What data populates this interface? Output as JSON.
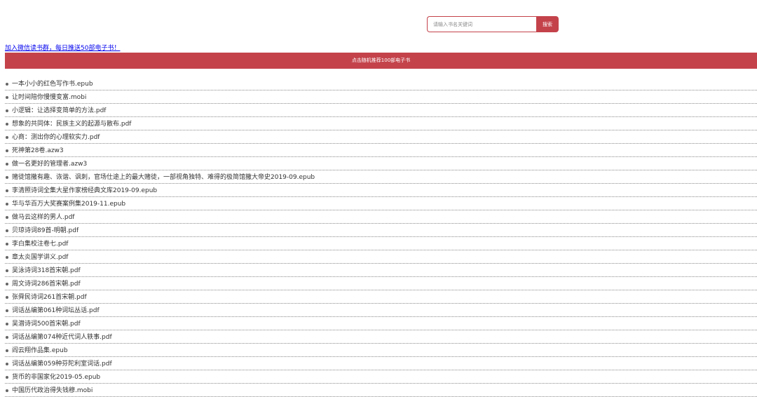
{
  "search": {
    "placeholder": "请输入书名关键词",
    "button_label": "搜索"
  },
  "promo_link": "加入微信读书群，每日推送50部电子书！",
  "random_bar_label": "点击随机推荐100部电子书",
  "books": [
    "一本小小的红色写作书.epub",
    "让时间陪你慢慢变富.mobi",
    "小逻辑：让选择变简单的方法.pdf",
    "想象的共同体：民族主义的起源与散布.pdf",
    "心商：测出你的心理软实力.pdf",
    "死神第28卷.azw3",
    "做一名更好的管理者.azw3",
    "赌徒馆撒有趣、诙谐、讽刺，官场仕途上的最大赌徒，一部视角独特、难得的极简馆撒大帝史2019-09.epub",
    "李清照诗词全集大星作家榜经典文库2019-09.epub",
    "华与华百万大奖赛案例集2019-11.epub",
    "做马云这样的男人.pdf",
    "贝琼诗词89首-明朝.pdf",
    "李白集校注卷七.pdf",
    "章太炎国学讲义.pdf",
    "吴泳诗词318首宋朝.pdf",
    "周文诗词286首宋朝.pdf",
    "张舜民诗词261首宋朝.pdf",
    "词话丛编第061种词坛丛话.pdf",
    "吴潜诗词500首宋朝.pdf",
    "词话丛编第074种近代词人轶事.pdf",
    "阎云翔作品集.epub",
    "词话丛编第059种芬陀利室词话.pdf",
    "货币的非国家化2019-05.epub",
    "中国历代政治得失钱穆.mobi"
  ]
}
